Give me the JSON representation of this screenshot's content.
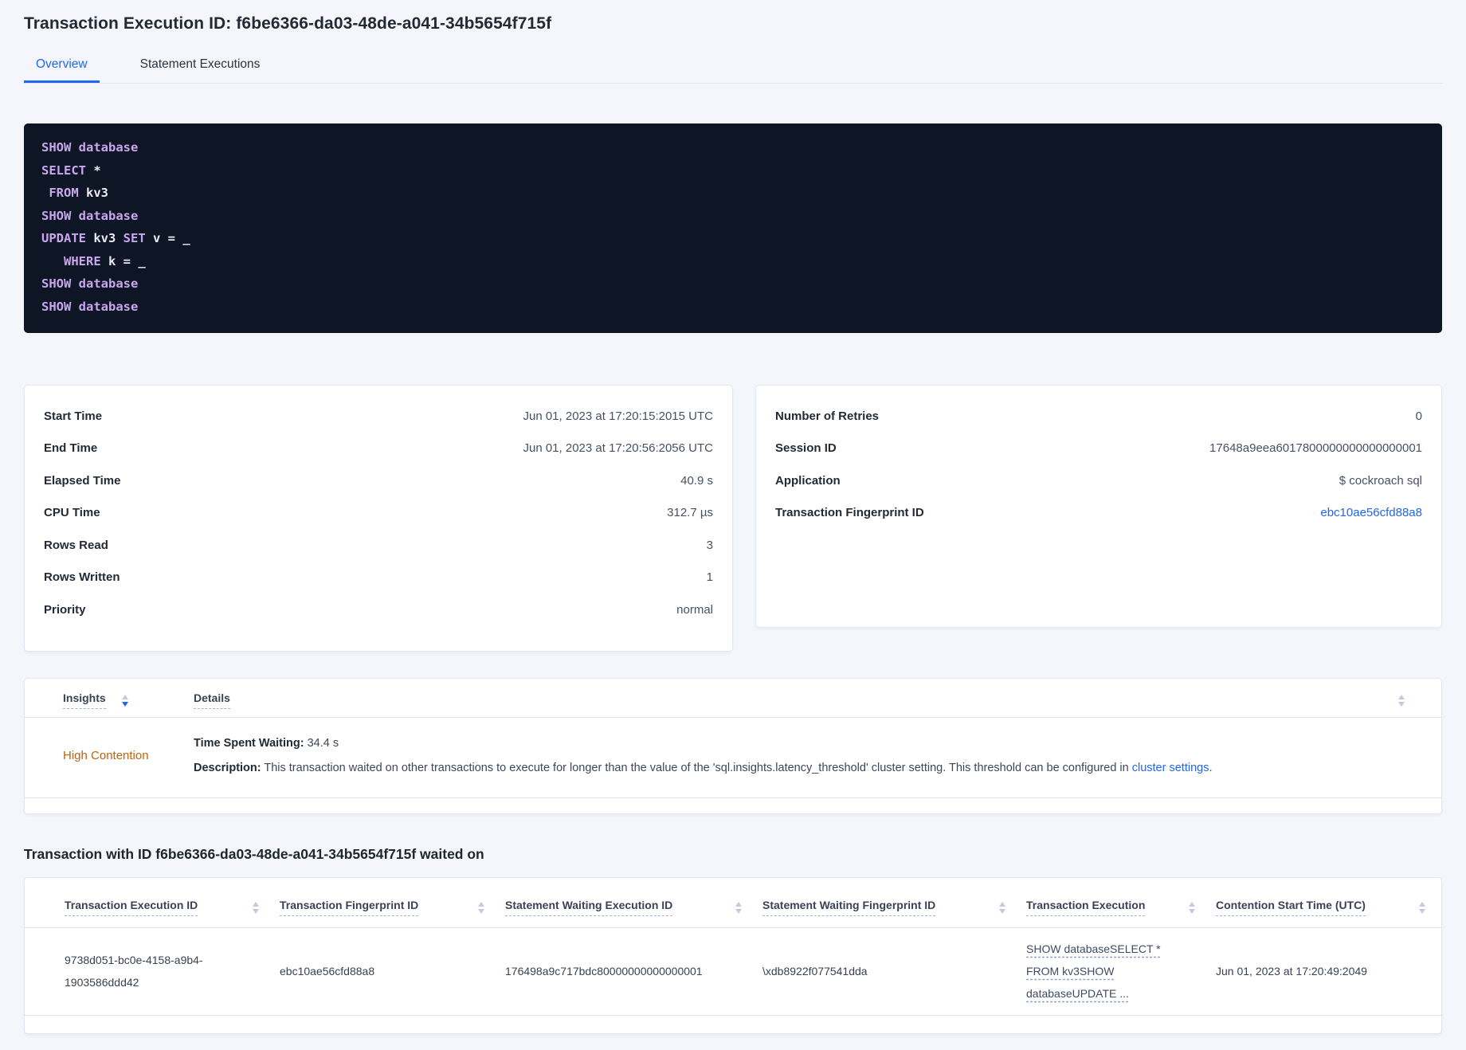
{
  "page": {
    "title": "Transaction Execution ID: f6be6366-da03-48de-a041-34b5654f715f"
  },
  "tabs": {
    "overview": "Overview",
    "statement_executions": "Statement Executions"
  },
  "sql": {
    "lines": [
      [
        {
          "v": "SHOW database"
        }
      ],
      [
        {
          "v": "SELECT"
        },
        {
          "v": " *"
        }
      ],
      [
        {
          "v": " "
        },
        {
          "v": "FROM"
        },
        {
          "v": " kv3"
        }
      ],
      [
        {
          "v": "SHOW database"
        }
      ],
      [
        {
          "v": "UPDATE"
        },
        {
          "v": " kv3 "
        },
        {
          "v": "SET"
        },
        {
          "v": " v = _"
        }
      ],
      [
        {
          "v": "   "
        },
        {
          "v": "WHERE"
        },
        {
          "v": " k = _"
        }
      ],
      [
        {
          "v": "SHOW database"
        }
      ],
      [
        {
          "v": "SHOW database"
        }
      ]
    ]
  },
  "overview_card": {
    "rows": [
      {
        "label": "Start Time",
        "value": "Jun 01, 2023 at 17:20:15:2015 UTC"
      },
      {
        "label": "End Time",
        "value": "Jun 01, 2023 at 17:20:56:2056 UTC"
      },
      {
        "label": "Elapsed Time",
        "value": "40.9 s"
      },
      {
        "label": "CPU Time",
        "value": "312.7 µs"
      },
      {
        "label": "Rows Read",
        "value": "3"
      },
      {
        "label": "Rows Written",
        "value": "1"
      },
      {
        "label": "Priority",
        "value": "normal"
      }
    ]
  },
  "session_card": {
    "rows": [
      {
        "label": "Number of Retries",
        "value": "0"
      },
      {
        "label": "Session ID",
        "value": "17648a9eea6017800000000000000001"
      },
      {
        "label": "Application",
        "value": "$ cockroach sql"
      },
      {
        "label": "Transaction Fingerprint ID",
        "value": "ebc10ae56cfd88a8"
      }
    ]
  },
  "insights": {
    "col_insights": "Insights",
    "col_details": "Details",
    "row": {
      "insight": "High Contention",
      "waiting_label": "Time Spent Waiting:",
      "waiting_value": " 34.4 s",
      "desc_label": "Description:",
      "desc_text": " This transaction waited on other transactions to execute for longer than the value of the 'sql.insights.latency_threshold' cluster setting. This threshold can be configured in ",
      "desc_link": "cluster settings",
      "desc_suffix": "."
    }
  },
  "waited_on": {
    "heading": "Transaction with ID f6be6366-da03-48de-a041-34b5654f715f waited on",
    "columns": [
      "Transaction Execution ID",
      "Transaction Fingerprint ID",
      "Statement Waiting Execution ID",
      "Statement Waiting Fingerprint ID",
      "Transaction Execution",
      "Contention Start Time (UTC)"
    ],
    "row": {
      "txn_execution_id": "9738d051-bc0e-4158-a9b4-1903586ddd42",
      "txn_fingerprint_id": "ebc10ae56cfd88a8",
      "stmt_waiting_execution_id": "176498a9c717bdc80000000000000001",
      "stmt_waiting_fingerprint_id": "\\xdb8922f077541dda",
      "txn_execution": "SHOW databaseSELECT * FROM kv3SHOW databaseUPDATE ...",
      "contention_start": "Jun 01, 2023 at 17:20:49:2049"
    }
  },
  "colors": {
    "accent_blue": "#1f66f5",
    "link_blue": "#2265f0",
    "insight_orange": "#c2610c",
    "code_background": "#0e1524",
    "code_keyword": "#c9a7ee"
  }
}
